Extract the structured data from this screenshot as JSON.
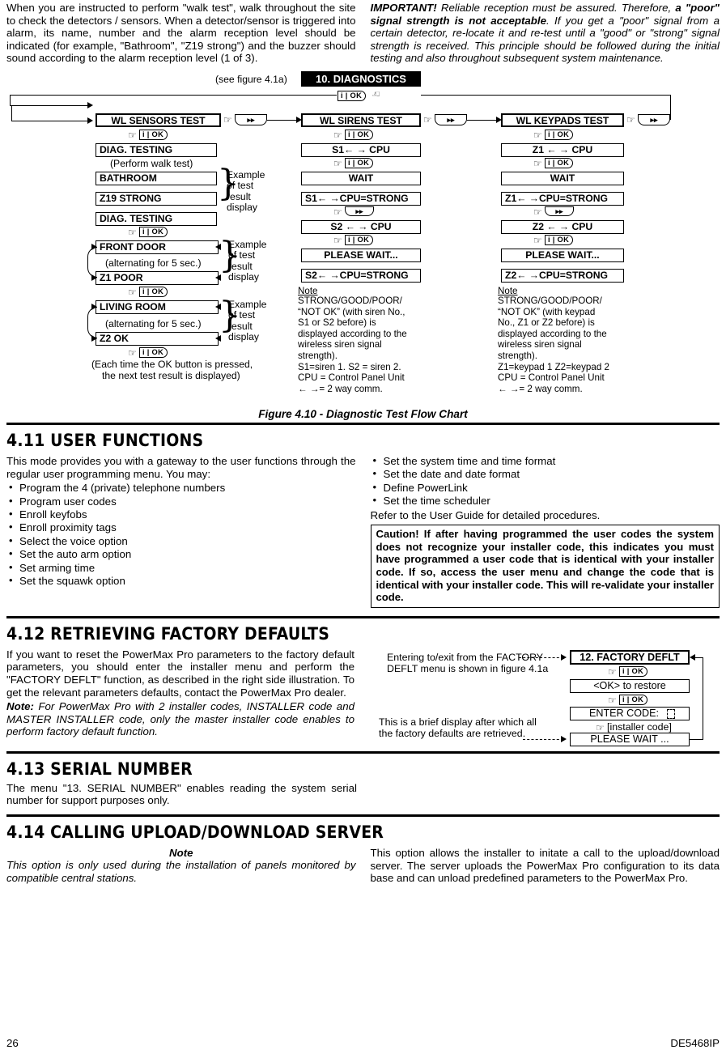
{
  "intro": {
    "left": "When you are instructed to perform \"walk test\", walk throughout the site to check the detectors / sensors. When a detector/sensor is triggered into alarm, its name, number and the alarm reception level should be indicated (for example, \"Bathroom\", \"Z19 strong\") and the buzzer should sound according to the alarm reception level (1 of 3).",
    "right_lead": "IMPORTANT!",
    "right_part1": " Reliable reception must be assured. Therefore, ",
    "right_bold": "a \"poor\" signal strength is not acceptable",
    "right_part2": ". If you get a \"poor\" signal from a certain detector, re-locate it and re-test until a \"good\" or \"strong\" signal strength is received. This principle should be followed during the initial testing and also throughout subsequent system maintenance."
  },
  "figure": {
    "caption": "Figure 4.10 - Diagnostic Test Flow Chart",
    "see_figure": "(see figure 4.1a)",
    "menu_title": "10. DIAGNOSTICS",
    "ok_key": "i | OK",
    "ff_key": "▸▸",
    "col1": {
      "title": "WL SENSORS TEST",
      "step1": "DIAG. TESTING",
      "step1_note": "(Perform walk test)",
      "ex1_a": "BATHROOM",
      "ex1_b": "Z19 STRONG",
      "step2": "DIAG. TESTING",
      "ex2_a": "FRONT DOOR",
      "ex2_alt": "(alternating for 5 sec.)",
      "ex2_b": "Z1 POOR",
      "ex3_a": "LIVING ROOM",
      "ex3_alt": "(alternating for 5 sec.)",
      "ex3_b": "Z2 OK",
      "example_label": "Example\nof test\nresult\ndisplay",
      "bottom_note_l1": "(Each time the OK button is pressed,",
      "bottom_note_l2": "the next test result is displayed)"
    },
    "col2": {
      "title": "WL SIRENS TEST",
      "s1": "S1←  →  CPU",
      "wait": "WAIT",
      "s1res": "S1← →CPU=STRONG",
      "s2": "S2 ←  → CPU",
      "pleasewait": "PLEASE WAIT...",
      "s2res": "S2← →CPU=STRONG",
      "note_head": "Note",
      "note_lines": [
        "STRONG/GOOD/POOR/",
        "“NOT OK” (with siren No.,",
        "S1 or S2 before) is",
        "displayed according to the",
        "wireless siren signal",
        "strength).",
        "S1=siren 1.  S2 = siren 2.",
        "CPU = Control Panel Unit",
        "← →= 2 way comm."
      ]
    },
    "col3": {
      "title": "WL KEYPADS TEST",
      "z1": "Z1 ←  →  CPU",
      "wait": "WAIT",
      "z1res": "Z1← →CPU=STRONG",
      "z2": "Z2 ←  → CPU",
      "pleasewait": "PLEASE WAIT...",
      "z2res": "Z2← →CPU=STRONG",
      "note_head": "Note",
      "note_lines": [
        "STRONG/GOOD/POOR/",
        "“NOT OK” (with keypad",
        "No., Z1 or Z2 before) is",
        "displayed according to the",
        "wireless siren signal",
        "strength).",
        "Z1=keypad 1 Z2=keypad 2",
        "CPU = Control Panel Unit",
        "← →= 2 way comm."
      ]
    }
  },
  "s411": {
    "heading": "4.11 USER FUNCTIONS",
    "body": "This mode provides you with a gateway to the user functions through the regular user programming menu. You may:",
    "bullets_left": [
      "Program the 4 (private) telephone numbers",
      "Program user codes",
      "Enroll keyfobs",
      "Enroll proximity tags",
      "Select the voice option",
      "Set the auto arm option",
      "Set arming time",
      "Set the squawk option"
    ],
    "bullets_right": [
      "Set the system time and time format",
      "Set the date and date format",
      "Define PowerLink",
      "Set the time scheduler"
    ],
    "refer": "Refer to the User Guide for detailed procedures.",
    "caution": "Caution! If after having programmed the user codes the system does not recognize your installer code, this indicates you must have programmed a user code that is identical with your installer code. If so, access the user menu and change the code that is identical with your installer code. This will re-validate your installer code."
  },
  "s412": {
    "heading": "4.12 RETRIEVING FACTORY DEFAULTS",
    "body": "If you want to reset the PowerMax Pro parameters to the factory default parameters, you should enter the installer menu and perform the \"FACTORY DEFLT\" function, as described in the right side illustration. To get the relevant parameters defaults, contact the PowerMax Pro dealer.",
    "note_label": "Note:",
    "note_body": " For PowerMax Pro with 2 installer codes, INSTALLER code and MASTER INSTALLER code, only the master installer code enables to perform factory default function.",
    "diagram": {
      "cap1_l1": "Entering to/exit from the FACTORY",
      "cap1_l2": "DEFLT menu is shown in figure 4.1a",
      "cap2_l1": "This is a brief display after which all",
      "cap2_l2": "the factory defaults are retrieved.",
      "box1": "12. FACTORY DEFLT",
      "box2": "<OK> to restore",
      "box3": "ENTER CODE:",
      "box4": "PLEASE WAIT ...",
      "ok_key": "i | OK",
      "installer_code": "[installer code]"
    }
  },
  "s413": {
    "heading": "4.13 SERIAL NUMBER",
    "body": "The menu \"13. SERIAL NUMBER\" enables reading the system serial number for support purposes only."
  },
  "s414": {
    "heading": "4.14 CALLING UPLOAD/DOWNLOAD SERVER",
    "note_title": "Note",
    "note_body": "This option is only used during the installation of panels monitored by compatible central stations.",
    "right_body": "This option allows the installer to initate a call to the upload/download server. The server uploads the PowerMax Pro configuration to its data base and can unload predefined parameters to the PowerMax Pro."
  },
  "footer": {
    "page": "26",
    "doc_id": "DE5468IP"
  }
}
